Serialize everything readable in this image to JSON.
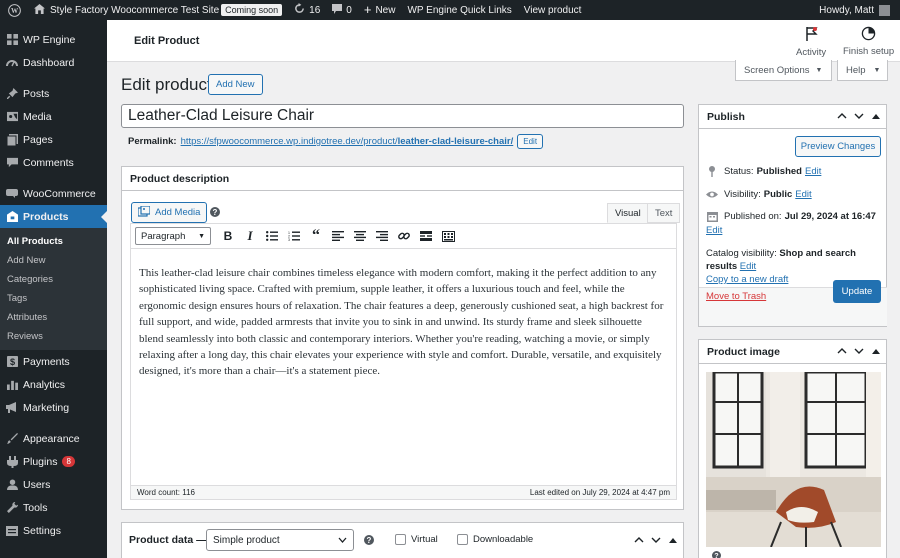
{
  "admin_bar": {
    "site_name": "Style Factory Woocommerce Test Site",
    "coming_soon": "Coming soon",
    "updates_count": "16",
    "comments_count": "0",
    "new_label": "New",
    "quick_links": "WP Engine Quick Links",
    "view_product": "View product",
    "howdy": "Howdy, Matt"
  },
  "sidebar": {
    "items": [
      {
        "label": "WP Engine",
        "icon": "wp-engine-icon"
      },
      {
        "label": "Dashboard",
        "icon": "dashboard-icon"
      },
      {
        "label": "Posts",
        "icon": "pin-icon"
      },
      {
        "label": "Media",
        "icon": "media-icon"
      },
      {
        "label": "Pages",
        "icon": "pages-icon"
      },
      {
        "label": "Comments",
        "icon": "comment-icon"
      },
      {
        "label": "WooCommerce",
        "icon": "woo-icon"
      },
      {
        "label": "Products",
        "icon": "products-icon"
      },
      {
        "label": "Payments",
        "icon": "dollar-icon"
      },
      {
        "label": "Analytics",
        "icon": "bar-chart-icon"
      },
      {
        "label": "Marketing",
        "icon": "megaphone-icon"
      },
      {
        "label": "Appearance",
        "icon": "brush-icon"
      },
      {
        "label": "Plugins",
        "icon": "plugin-icon",
        "badge": "8"
      },
      {
        "label": "Users",
        "icon": "user-icon"
      },
      {
        "label": "Tools",
        "icon": "wrench-icon"
      },
      {
        "label": "Settings",
        "icon": "settings-icon"
      }
    ],
    "products_submenu": [
      "All Products",
      "Add New",
      "Categories",
      "Tags",
      "Attributes",
      "Reviews"
    ]
  },
  "header": {
    "page_title": "Edit Product",
    "activity": "Activity",
    "finish_setup": "Finish setup",
    "screen_options": "Screen Options",
    "help": "Help"
  },
  "main": {
    "heading": "Edit product",
    "add_new": "Add New",
    "title_value": "Leather-Clad Leisure Chair",
    "permalink_label": "Permalink:",
    "permalink_base": "https://sfpwoocommerce.wp.indigotree.dev/product/",
    "permalink_slug": "leather-clad-leisure-chair/",
    "permalink_edit": "Edit"
  },
  "description": {
    "heading": "Product description",
    "add_media": "Add Media",
    "tab_visual": "Visual",
    "tab_text": "Text",
    "format": "Paragraph",
    "content": "This leather-clad leisure chair combines timeless elegance with modern comfort, making it the perfect addition to any sophisticated living space. Crafted with premium, supple leather, it offers a luxurious touch and feel, while the ergonomic design ensures hours of relaxation. The chair features a deep, generously cushioned seat, a high backrest for full support, and wide, padded armrests that invite you to sink in and unwind. Its sturdy frame and sleek silhouette blend seamlessly into both classic and contemporary interiors. Whether you're reading, watching a movie, or simply relaxing after a long day, this chair elevates your experience with style and comfort. Durable, versatile, and exquisitely designed, it's more than a chair—it's a statement piece.",
    "word_count": "Word count: 116",
    "last_edited": "Last edited on July 29, 2024 at 4:47 pm"
  },
  "product_data": {
    "heading": "Product data —",
    "type": "Simple product",
    "virtual": "Virtual",
    "downloadable": "Downloadable"
  },
  "publish": {
    "heading": "Publish",
    "preview": "Preview Changes",
    "status_label": "Status:",
    "status_value": "Published",
    "visibility_label": "Visibility:",
    "visibility_value": "Public",
    "published_label": "Published on:",
    "published_value": "Jul 29, 2024 at 16:47",
    "catalog_label": "Catalog visibility:",
    "catalog_value": "Shop and search results",
    "edit": "Edit",
    "copy_draft": "Copy to a new draft",
    "trash": "Move to Trash",
    "update": "Update"
  },
  "product_image": {
    "heading": "Product image"
  },
  "colors": {
    "admin_dark": "#1d2327",
    "accent": "#2271b1",
    "danger": "#d63638"
  }
}
